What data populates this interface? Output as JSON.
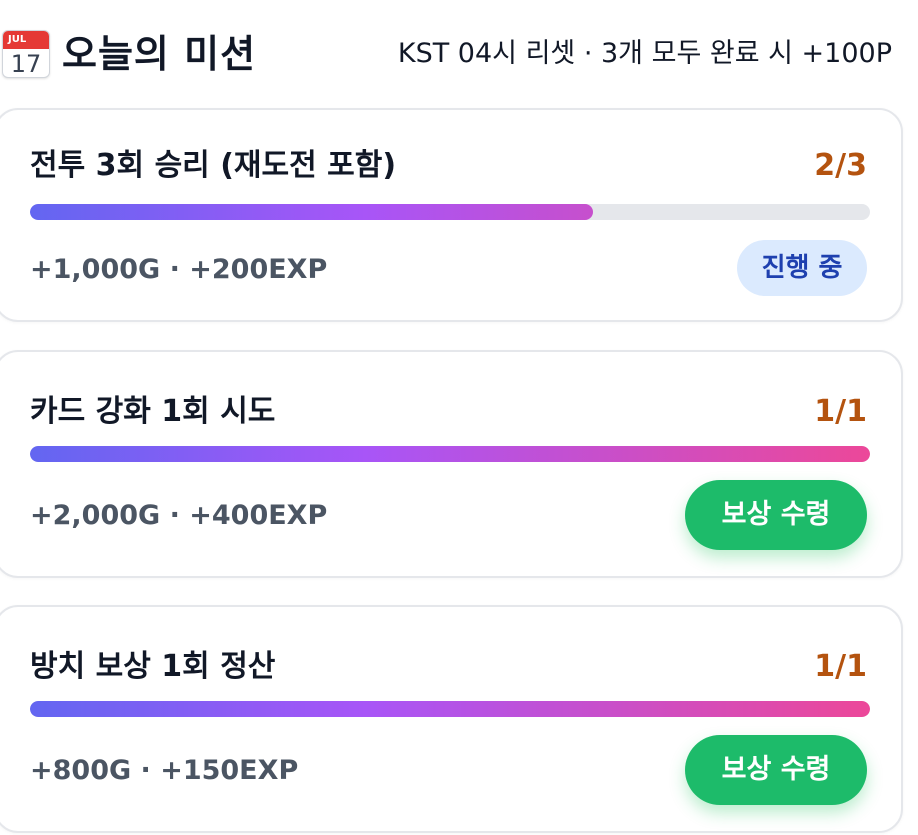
{
  "header": {
    "icon": "calendar-icon",
    "calendar_month": "JUL",
    "calendar_day": "17",
    "title": "오늘의 미션",
    "subtitle": "KST 04시 리셋 · 3개 모두 완료 시 +100P"
  },
  "colors": {
    "progress_text": "#b4530f",
    "bar_start": "#6366f1",
    "bar_mid": "#a855f7",
    "bar_end": "#ec4899",
    "claim_button": "#1dbb6a",
    "in_progress_badge_bg": "#dbeafe",
    "in_progress_badge_text": "#1e40af"
  },
  "missions": [
    {
      "title": "전투 3회 승리 (재도전 포함)",
      "progress_text": "2/3",
      "progress_fraction": 0.67,
      "reward": "+1,000G · +200EXP",
      "status_label": "진행 중"
    },
    {
      "title": "카드 강화 1회 시도",
      "progress_text": "1/1",
      "progress_fraction": 1.0,
      "reward": "+2,000G · +400EXP",
      "action_label": "보상 수령"
    },
    {
      "title": "방치 보상 1회 정산",
      "progress_text": "1/1",
      "progress_fraction": 1.0,
      "reward": "+800G · +150EXP",
      "action_label": "보상 수령"
    }
  ]
}
